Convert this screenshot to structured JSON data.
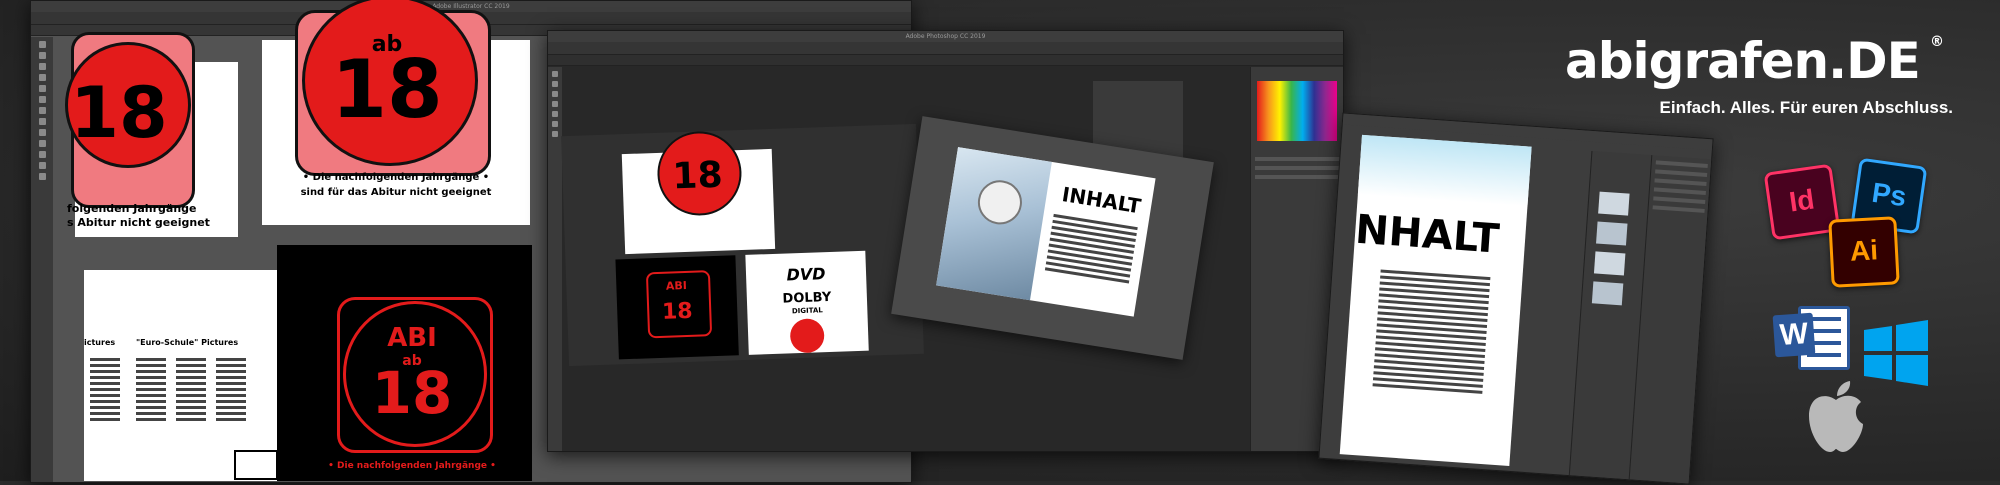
{
  "logo": {
    "wordmark": "abigrafen.DE",
    "registered": "®",
    "tagline": "Einfach. Alles. Für euren Abschluss."
  },
  "apps": {
    "indesign": "Id",
    "photoshop": "Ps",
    "illustrator": "Ai"
  },
  "windows": {
    "illustrator_title": "Adobe Illustrator CC 2019",
    "photoshop_title": "Adobe Photoshop CC 2019"
  },
  "artwork": {
    "ab": "ab",
    "eighteen": "18",
    "abi": "ABI",
    "notice_line1": "• Die nachfolgenden Jahrgänge •",
    "notice_line2": "sind für das Abitur nicht geeignet",
    "notice_short": "folgenden Jahrgänge",
    "notice_short2": "s Abitur nicht geeignet",
    "red_notice": "• Die nachfolgenden Jahrgänge •",
    "school_label": "\"Euro-Schule\" Pictures",
    "pictures": "ictures",
    "dvd": "DVD",
    "dolby": "DOLBY",
    "digital": "DIGITAL",
    "inhalt": "INHALT",
    "nhalt": "NHALT"
  },
  "colors": {
    "red": "#e31b1b",
    "id_bg": "#49021f",
    "id_accent": "#ff3366",
    "ps_bg": "#001e36",
    "ps_accent": "#31a8ff",
    "ai_bg": "#330000",
    "ai_accent": "#ff9a00",
    "word": "#2b579a",
    "windows": "#00a4ef"
  },
  "icons": [
    "indesign-icon",
    "photoshop-icon",
    "illustrator-icon",
    "word-icon",
    "windows-icon",
    "apple-icon"
  ]
}
